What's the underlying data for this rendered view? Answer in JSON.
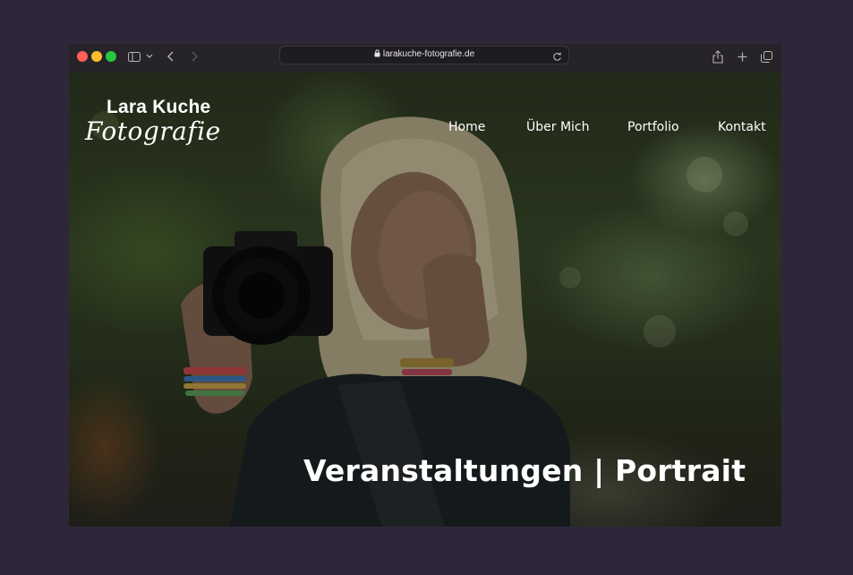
{
  "browser": {
    "address": "larakuche-fotografie.de"
  },
  "site": {
    "brand_name": "Lara Kuche",
    "brand_sub": "Fotografie",
    "nav": {
      "home": "Home",
      "ueber_mich": "Über Mich",
      "portfolio": "Portfolio",
      "kontakt": "Kontakt"
    },
    "headline": "Veranstaltungen | Portrait"
  },
  "colors": {
    "desktop_background": "#2f2739",
    "toolbar": "#262329",
    "traffic_red": "#ff5f57",
    "traffic_yellow": "#febc2e",
    "traffic_green": "#28c840"
  }
}
